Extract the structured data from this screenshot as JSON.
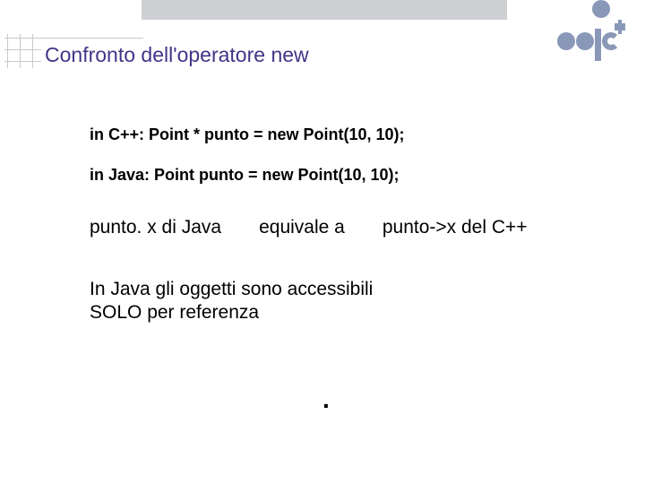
{
  "title": "Confronto dell'operatore new",
  "code": {
    "cpp_line": "in C++:  Point * punto = new Point(10, 10);",
    "java_line": "in Java:  Point  punto = new Point(10, 10);"
  },
  "equivalence": {
    "left": "punto. x di Java",
    "mid": "equivale a",
    "right": "punto->x del C++"
  },
  "paragraph_line1": "In  Java gli oggetti sono accessibili",
  "paragraph_line2": "SOLO per referenza",
  "footer_dot": "."
}
